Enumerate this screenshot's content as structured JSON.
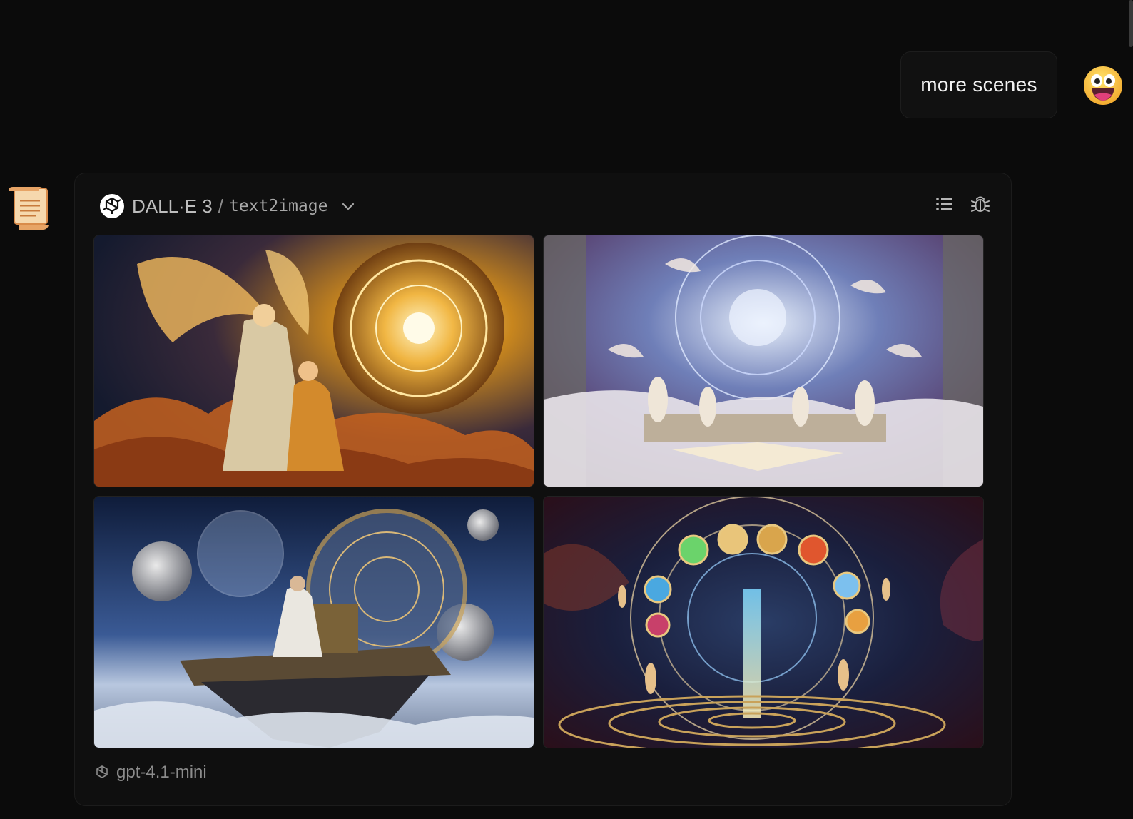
{
  "user_message": {
    "text": "more scenes",
    "avatar_icon": "grinning-face-icon"
  },
  "assistant": {
    "avatar_icon": "scroll-icon",
    "card": {
      "provider_icon": "openai-logo-icon",
      "model_name": "DALL·E 3",
      "separator": "/",
      "task": "text2image",
      "actions": [
        "list-icon",
        "bug-icon"
      ],
      "images": [
        {
          "name": "generated-image-1",
          "subject": "golden angel and sage before celestial zodiac wheel in clouds"
        },
        {
          "name": "generated-image-2",
          "subject": "watercolor angels reading books beneath cosmic astrolabe"
        },
        {
          "name": "generated-image-3",
          "subject": "scholar at astronomical machine on floating island among planets"
        },
        {
          "name": "generated-image-4",
          "subject": "radiant zodiac mandala with angels over spiral platform"
        }
      ],
      "footer_model": "gpt-4.1-mini"
    }
  },
  "colors": {
    "background": "#0b0b0b",
    "card": "#0f0f0f",
    "bubble": "#111111"
  }
}
